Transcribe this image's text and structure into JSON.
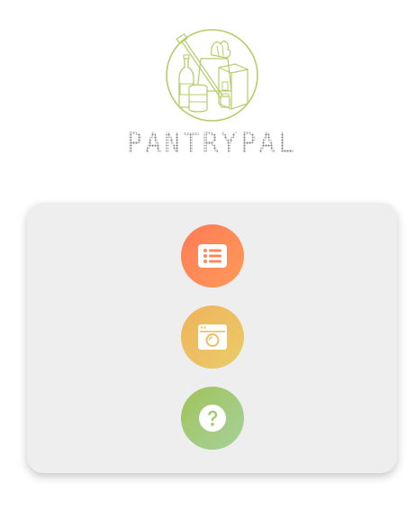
{
  "app": {
    "brand_name": "PANTRYPAL"
  },
  "logo": {
    "icon": "pantry-groceries-icon",
    "color": "#b5cc6a"
  },
  "menu": {
    "buttons": [
      {
        "icon": "list-icon",
        "color_start": "#ff7b56",
        "color_end": "#ff9a5a"
      },
      {
        "icon": "pantry-window-icon",
        "color_start": "#f0b35a",
        "color_end": "#e9cc6a"
      },
      {
        "icon": "help-icon",
        "color_start": "#9fc35b",
        "color_end": "#a7d19b"
      }
    ]
  }
}
